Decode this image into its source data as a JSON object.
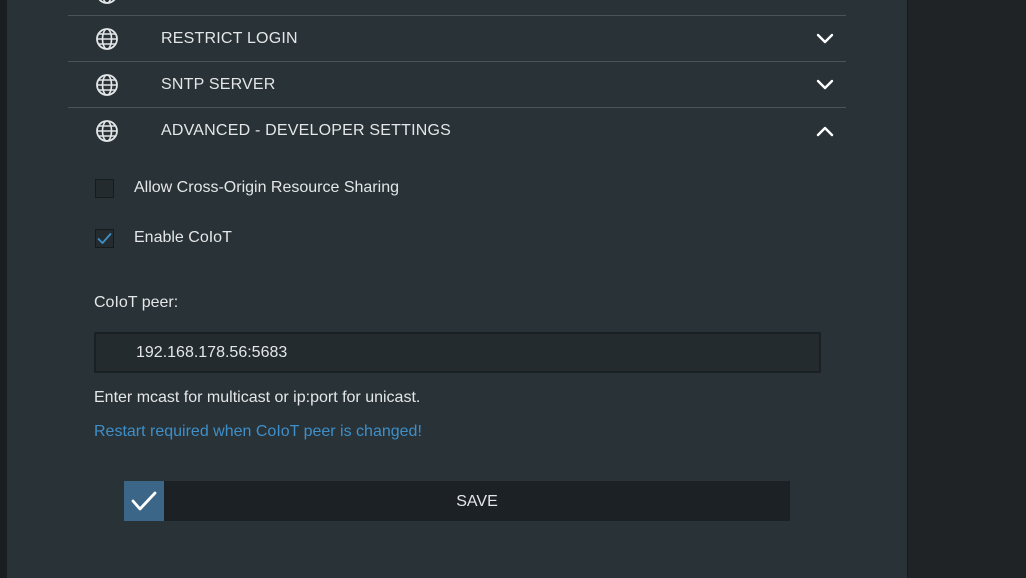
{
  "sections": [
    {
      "label": "RESTRICT LOGIN",
      "icon": "globe-icon",
      "expanded": false
    },
    {
      "label": "SNTP SERVER",
      "icon": "globe-icon",
      "expanded": false
    },
    {
      "label": "ADVANCED - DEVELOPER SETTINGS",
      "icon": "globe-icon",
      "expanded": true
    }
  ],
  "advanced": {
    "cors_label": "Allow Cross-Origin Resource Sharing",
    "cors_checked": false,
    "coiot_label": "Enable CoIoT",
    "coiot_checked": true,
    "peer_label": "CoIoT peer:",
    "peer_value": "192.168.178.56:5683",
    "hint": "Enter mcast for multicast or ip:port for unicast.",
    "warning": "Restart required when CoIoT peer is changed!",
    "save_label": "SAVE"
  },
  "colors": {
    "panel": "#283237",
    "accent": "#3b6687",
    "warning_text": "#3f8fc9",
    "text": "#e4e6e7"
  }
}
